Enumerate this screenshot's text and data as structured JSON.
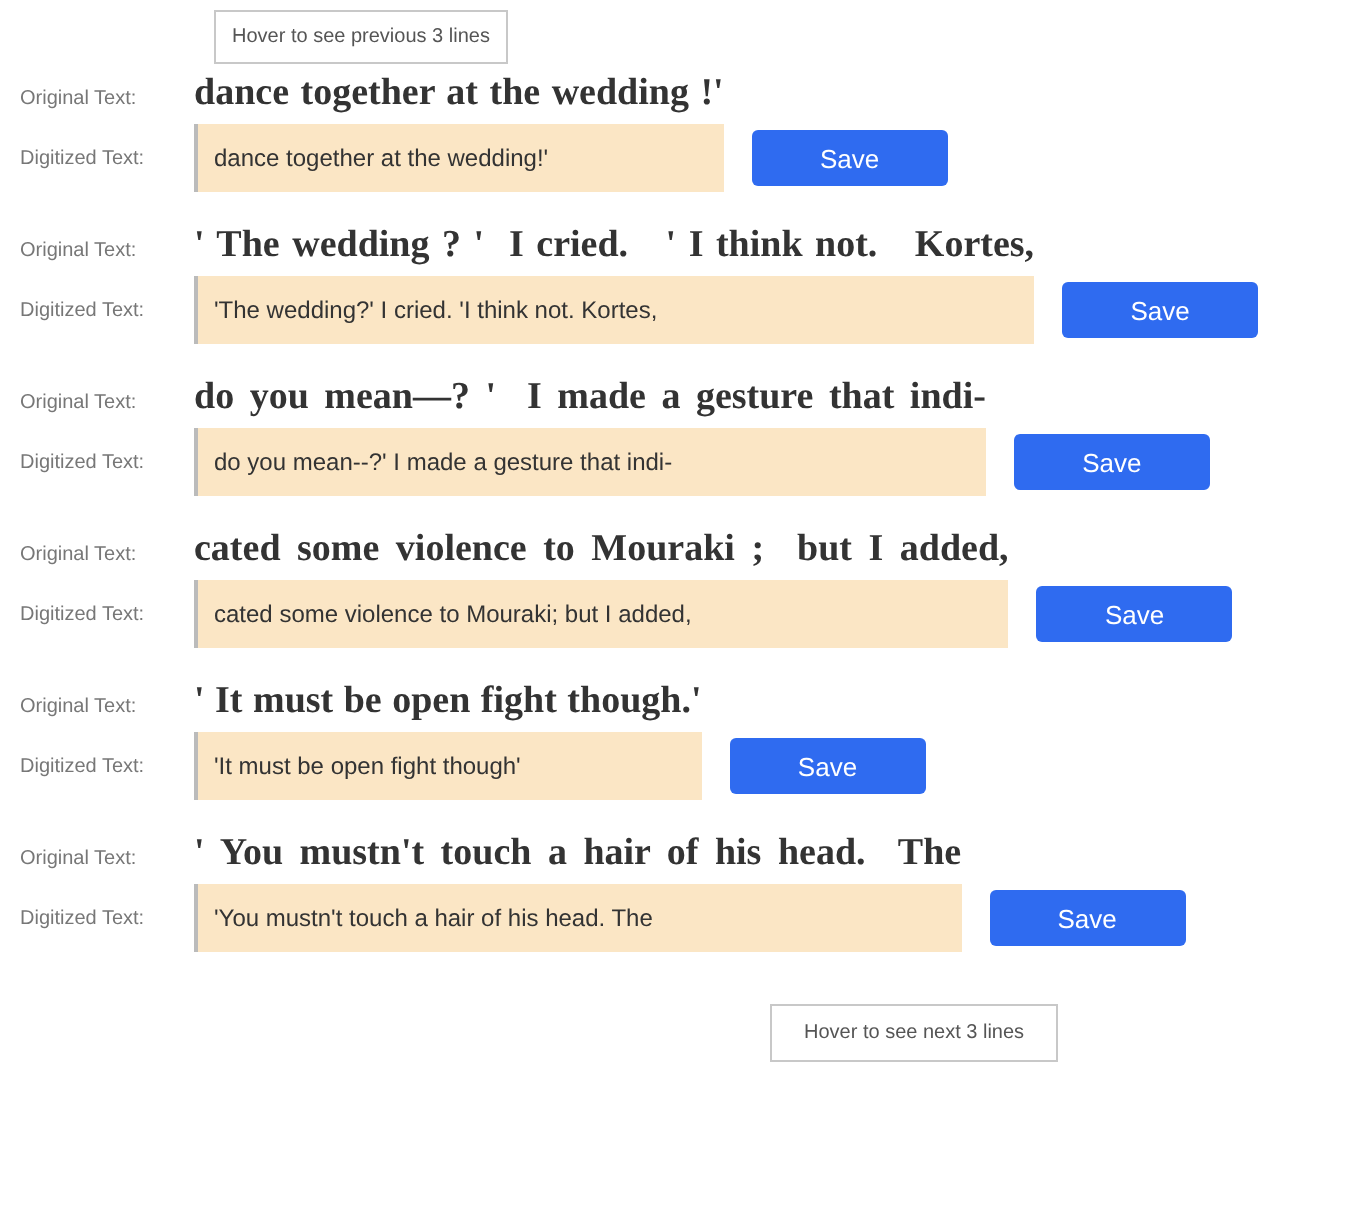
{
  "previous_hint": "Hover to see previous 3 lines",
  "lines": [
    {
      "original_label": "Original Text:",
      "original": "dance together at the wedding !'",
      "digitized_label": "Digitized Text:",
      "digitized": "dance together at the wedding!'",
      "button": "Save"
    },
    {
      "original_label": "Original Text:",
      "original": "' The wedding ? '  I cried.   ' I think not.   Kortes,",
      "digitized_label": "Digitized Text:",
      "digitized": "'The wedding?' I cried. 'I think not. Kortes,",
      "button": "Save"
    },
    {
      "original_label": "Original Text:",
      "original": "do you mean—? '  I made a gesture that indi-",
      "digitized_label": "Digitized Text:",
      "digitized": "do you mean--?' I made a gesture that indi-",
      "button": "Save"
    },
    {
      "original_label": "Original Text:",
      "original": "cated some violence to Mouraki ;  but I added,",
      "digitized_label": "Digitized Text:",
      "digitized": "cated some violence to Mouraki; but I added,",
      "button": "Save"
    },
    {
      "original_label": "Original Text:",
      "original": "' It must be open fight though.'",
      "digitized_label": "Digitized Text:",
      "digitized": "'It must be open fight though'",
      "button": "Save"
    },
    {
      "original_label": "Original Text:",
      "original": "' You mustn't touch a hair of his head.  The",
      "digitized_label": "Digitized Text:",
      "digitized": "'You mustn't touch a hair of his head. The",
      "button": "Save"
    }
  ],
  "next_hint": "Hover to see next 3 lines"
}
